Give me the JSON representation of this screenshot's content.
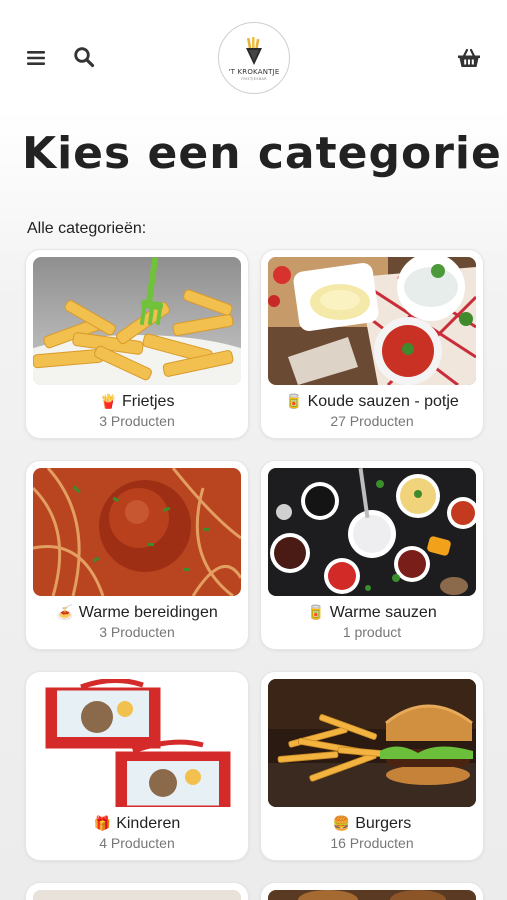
{
  "header": {
    "logo_name": "'T KROKANTJE",
    "logo_sub": "FRIETJESBAR",
    "menu_icon": "hamburger-menu-icon",
    "search_icon": "search-icon",
    "cart_icon": "basket-icon"
  },
  "page_title": "Kies een categorie",
  "section_label": "Alle categorieën:",
  "categories": [
    {
      "emoji": "🍟",
      "name": "Frietjes",
      "count": "3 Producten",
      "image": "fries"
    },
    {
      "emoji": "🥫",
      "name": "Koude sauzen - potje",
      "count": "27 Producten",
      "image": "cold-sauces"
    },
    {
      "emoji": "🍝",
      "name": "Warme bereidingen",
      "count": "3 Producten",
      "image": "meatball-spaghetti"
    },
    {
      "emoji": "🥫",
      "name": "Warme sauzen",
      "count": "1 product",
      "image": "warm-sauces"
    },
    {
      "emoji": "🎁",
      "name": "Kinderen",
      "count": "4 Producten",
      "image": "kids-boxes"
    },
    {
      "emoji": "🍔",
      "name": "Burgers",
      "count": "16 Producten",
      "image": "burger"
    }
  ]
}
